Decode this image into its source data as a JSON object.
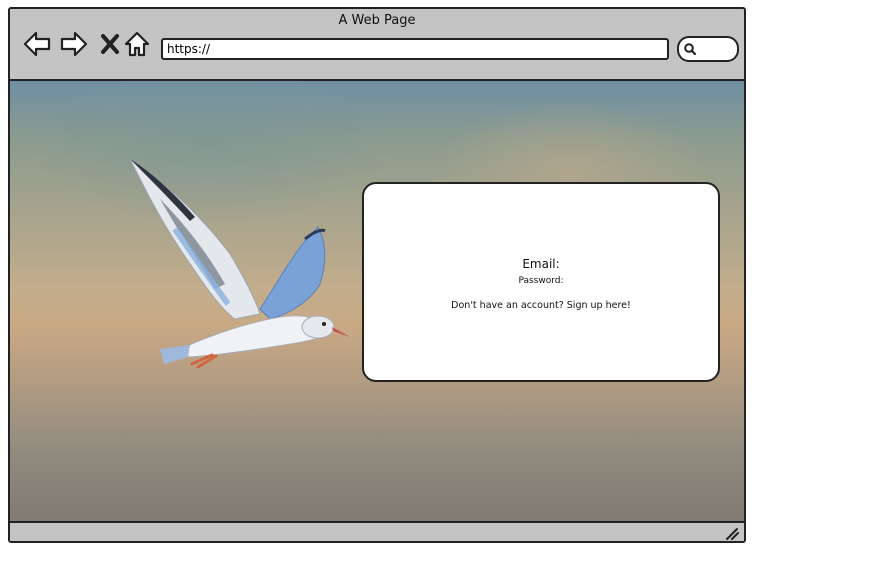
{
  "window": {
    "title": "A Web Page"
  },
  "toolbar": {
    "icons": [
      "back-arrow-icon",
      "forward-arrow-icon",
      "close-icon",
      "home-icon",
      "search-icon"
    ],
    "url": "https://"
  },
  "login": {
    "email_label": "Email:",
    "password_label": "Password:",
    "signup_text": "Don't have an account? Sign up here!"
  },
  "colors": {
    "frame": "#c4c4c4",
    "border": "#222222",
    "card": "#ffffff"
  }
}
